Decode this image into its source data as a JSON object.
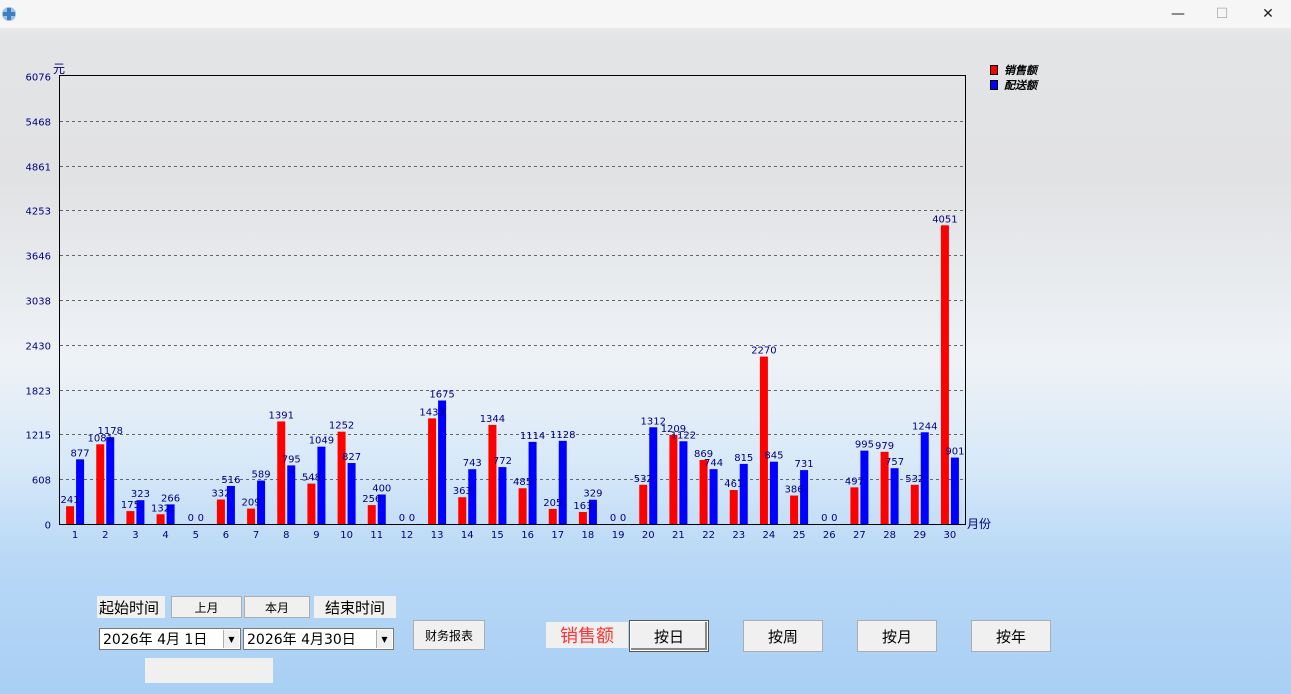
{
  "colors": {
    "sales": "#ff0000",
    "delivery": "#0000ff",
    "axis_text": "#00007f",
    "title_red": "#ff3333"
  },
  "window": {
    "minimize": "—",
    "maximize": "☐",
    "close": "✕"
  },
  "chart_data": {
    "type": "bar",
    "ylabel": "元",
    "xlabel": "月份",
    "yticks": [
      0,
      608,
      1215,
      1823,
      2430,
      3038,
      3646,
      4253,
      4861,
      5468,
      6076
    ],
    "ylim": [
      0,
      6076
    ],
    "grid": true,
    "legend_position": "top-right",
    "categories": [
      "1",
      "2",
      "3",
      "4",
      "5",
      "6",
      "7",
      "8",
      "9",
      "10",
      "11",
      "12",
      "13",
      "14",
      "15",
      "16",
      "17",
      "18",
      "19",
      "20",
      "21",
      "22",
      "23",
      "24",
      "25",
      "26",
      "27",
      "28",
      "29",
      "30"
    ],
    "series": [
      {
        "name": "销售额",
        "values": [
          241,
          1081,
          175,
          132,
          0,
          332,
          209,
          1391,
          548,
          1252,
          256,
          0,
          1433,
          363,
          1344,
          485,
          205,
          163,
          0,
          532,
          1209,
          869,
          461,
          2270,
          386,
          0,
          497,
          979,
          532,
          4051
        ]
      },
      {
        "name": "配送额",
        "values": [
          877,
          1178,
          323,
          266,
          0,
          516,
          589,
          795,
          1049,
          827,
          400,
          0,
          1675,
          743,
          772,
          1114,
          1128,
          329,
          0,
          1312,
          1122,
          744,
          815,
          845,
          731,
          0,
          995,
          757,
          1244,
          901
        ]
      }
    ]
  },
  "controls": {
    "start_label": "起始时间",
    "last_month": "上月",
    "this_month": "本月",
    "end_label": "结束时间",
    "start_date": "2026年  4月  1日",
    "end_date": "2026年  4月30日",
    "finance_report": "财务报表",
    "metric_title": "销售额",
    "by_day": "按日",
    "by_week": "按周",
    "by_month": "按月",
    "by_year": "按年"
  }
}
